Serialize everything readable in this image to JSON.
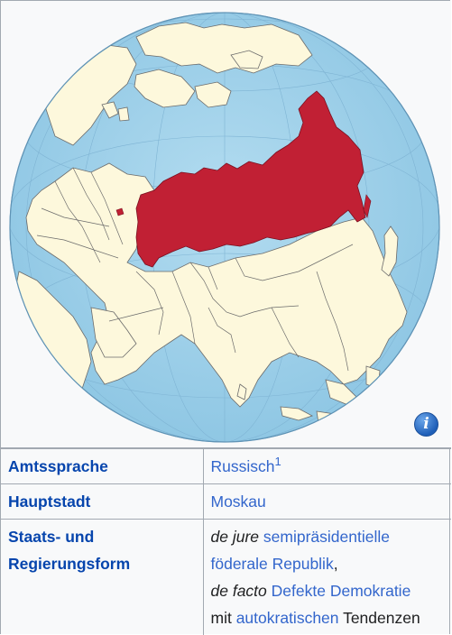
{
  "map": {
    "icon": "info-icon",
    "icon_glyph": "i",
    "colors": {
      "ocean": "#a8d6ec",
      "land": "#fdf8dc",
      "highlight": "#c12034",
      "border": "#555555"
    }
  },
  "rows": {
    "amtssprache": {
      "label": "Amtssprache",
      "value_link": "Russisch",
      "footnote": "1"
    },
    "hauptstadt": {
      "label": "Hauptstadt",
      "value_link": "Moskau"
    },
    "regierungsform": {
      "label_line1": "Staats- und",
      "label_line2": "Regierungsform",
      "dejure_prefix": "de jure",
      "dejure_link": "semipräsidentielle föderale Republik",
      "dejure_suffix": ",",
      "defacto_prefix": "de facto",
      "defacto_link": "Defekte Demokratie",
      "mit_text": "mit",
      "autokratisch_link": "autokratischen",
      "tendenzen_text": "Tendenzen"
    }
  }
}
